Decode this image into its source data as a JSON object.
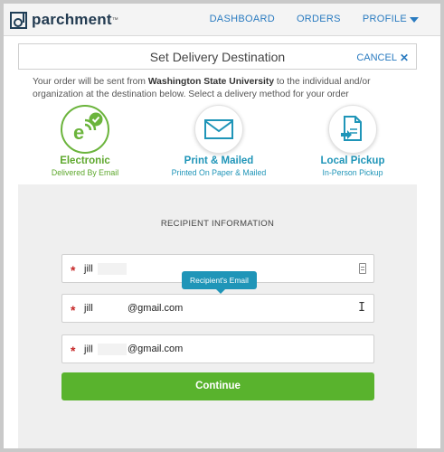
{
  "nav": {
    "logo": "parchment",
    "items": [
      "DASHBOARD",
      "ORDERS",
      "PROFILE"
    ]
  },
  "header": {
    "title": "Set Delivery Destination",
    "cancel": "CANCEL"
  },
  "intro": {
    "part1": "Your order will be sent from ",
    "institution": "Washington State University",
    "part2": " to the individual and/or organization at the destination below. Select a delivery method for your order"
  },
  "methods": [
    {
      "title": "Electronic",
      "subtitle": "Delivered By Email",
      "icon": "electronic-check-icon",
      "selected": true
    },
    {
      "title": "Print & Mailed",
      "subtitle": "Printed On Paper & Mailed",
      "icon": "envelope-icon",
      "selected": false
    },
    {
      "title": "Local Pickup",
      "subtitle": "In-Person Pickup",
      "icon": "document-pickup-icon",
      "selected": false
    }
  ],
  "recipient": {
    "heading": "RECIPIENT INFORMATION",
    "name_value": "jill",
    "email_value": "jill",
    "email_domain": "@gmail.com",
    "confirm_value": "jill",
    "confirm_domain": "@gmail.com",
    "tooltip": "Recipient's Email",
    "required_mark": "*"
  },
  "actions": {
    "continue": "Continue"
  },
  "colors": {
    "accent_blue": "#2a7bc0",
    "teal": "#1f95b8",
    "green": "#59b32d",
    "required": "#c62828"
  }
}
